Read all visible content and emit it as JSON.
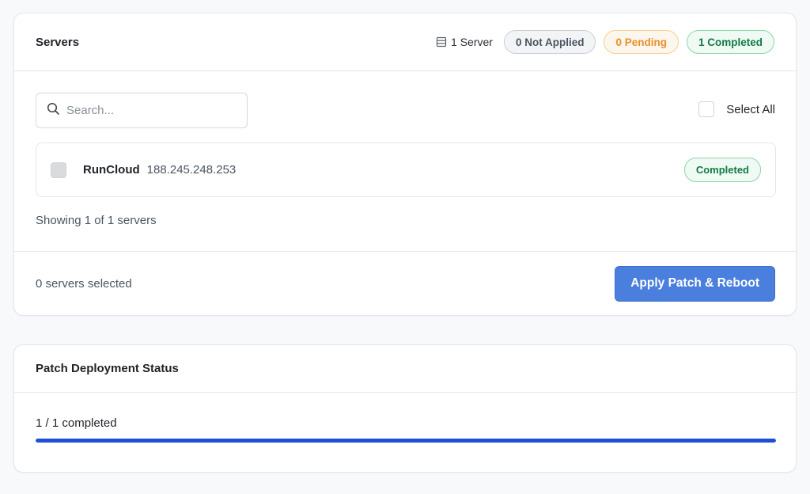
{
  "servers_card": {
    "title": "Servers",
    "server_count": "1 Server",
    "badges": {
      "not_applied_count": "0",
      "not_applied_label": "Not Applied",
      "pending": "0 Pending",
      "completed": "1 Completed"
    },
    "search": {
      "placeholder": "Search...",
      "value": ""
    },
    "select_all_label": "Select All",
    "servers": [
      {
        "name": "RunCloud",
        "ip": "188.245.248.253",
        "status": "Completed"
      }
    ],
    "showing_text": "Showing 1 of 1 servers",
    "selected_text": "0 servers selected",
    "apply_button": "Apply Patch & Reboot"
  },
  "status_card": {
    "title": "Patch Deployment Status",
    "progress_text": "1 / 1 completed",
    "progress_fraction": 1.0
  },
  "colors": {
    "accent": "#4a7fde",
    "progress": "#1e50d6",
    "pending": "#e8912a",
    "completed": "#137a45"
  },
  "icons": {
    "server": "server-icon",
    "search": "search-icon"
  }
}
